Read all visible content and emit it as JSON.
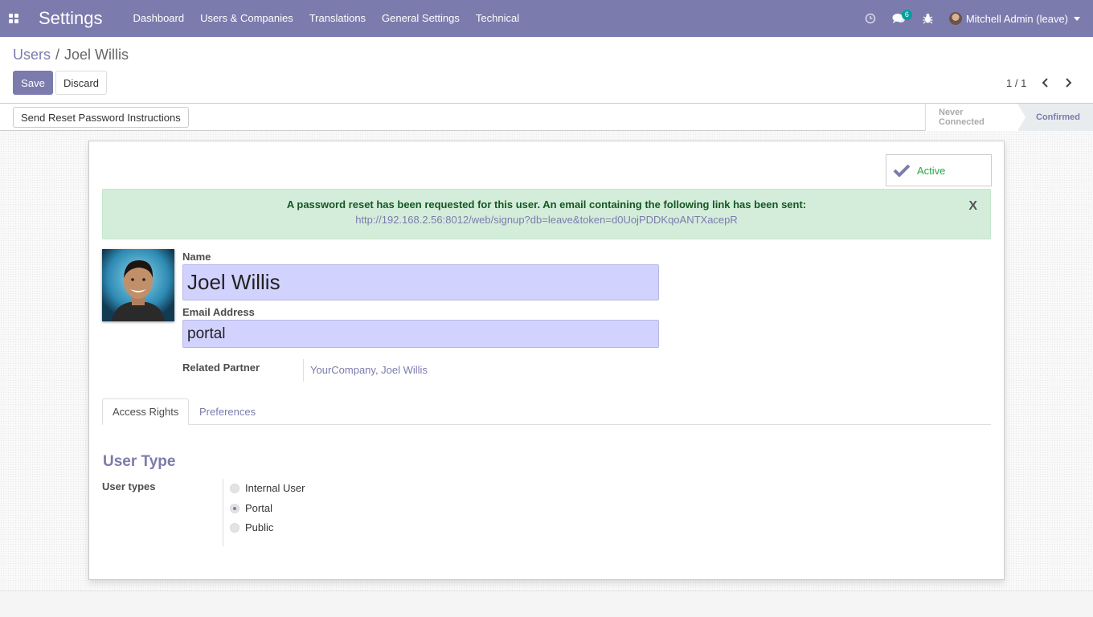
{
  "navbar": {
    "app_title": "Settings",
    "menu": [
      "Dashboard",
      "Users & Companies",
      "Translations",
      "General Settings",
      "Technical"
    ],
    "messages_count": "6",
    "user_name": "Mitchell Admin (leave)"
  },
  "breadcrumb": {
    "parent": "Users",
    "separator": "/",
    "current": "Joel Willis"
  },
  "buttons": {
    "save": "Save",
    "discard": "Discard",
    "reset_password": "Send Reset Password Instructions"
  },
  "pager": {
    "value": "1 / 1"
  },
  "status": {
    "stages": [
      "Never Connected",
      "Confirmed"
    ],
    "current": "Confirmed"
  },
  "form": {
    "active_label": "Active",
    "alert_title": "A password reset has been requested for this user. An email containing the following link has been sent:",
    "alert_link": "http://192.168.2.56:8012/web/signup?db=leave&token=d0UojPDDKqoANTXacepR",
    "alert_close": "X",
    "name_label": "Name",
    "name_value": "Joel Willis",
    "email_label": "Email Address",
    "email_value": "portal",
    "partner_label": "Related Partner",
    "partner_value": "YourCompany, Joel Willis",
    "tabs": [
      "Access Rights",
      "Preferences"
    ],
    "section_title": "User Type",
    "user_types_label": "User types",
    "user_types": [
      "Internal User",
      "Portal",
      "Public"
    ],
    "selected_user_type": "Portal"
  },
  "colors": {
    "brand": "#7c7bad",
    "success": "#28a745",
    "alert_bg": "#d4edda",
    "input_bg": "#d2d2ff"
  }
}
